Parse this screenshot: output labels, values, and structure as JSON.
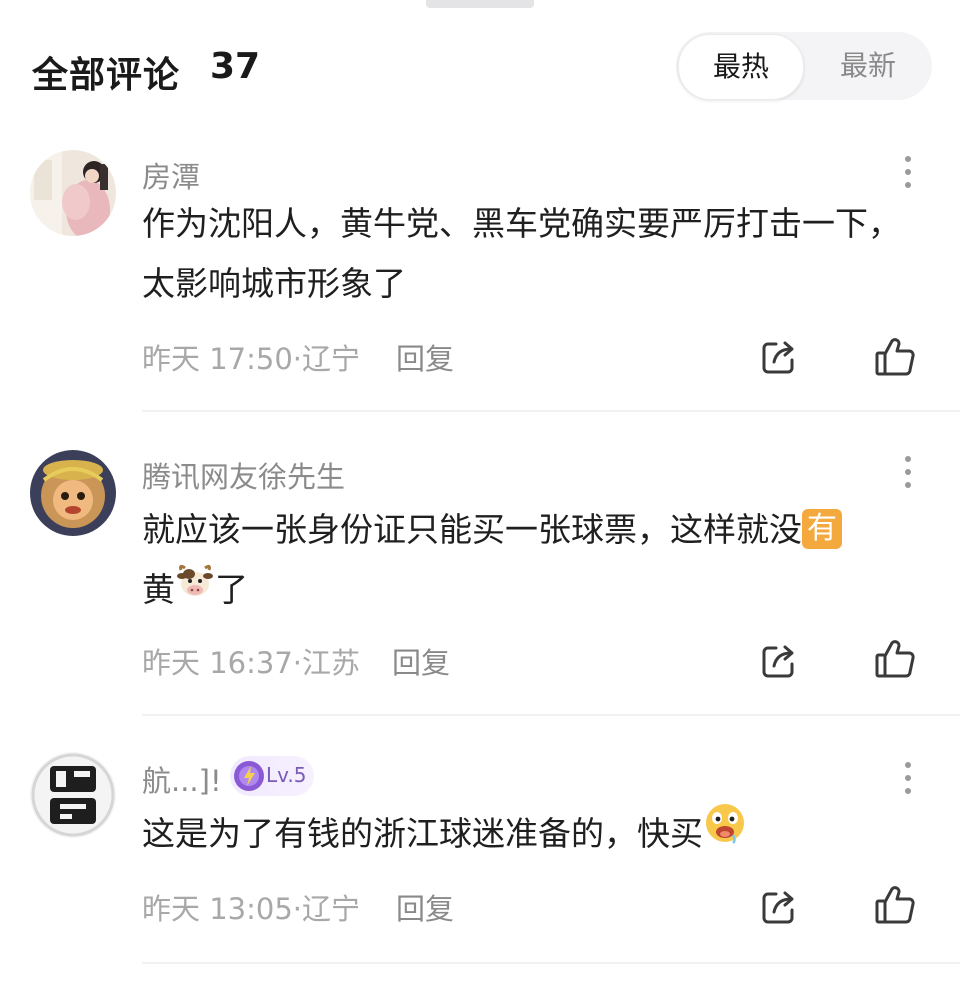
{
  "header": {
    "title": "全部评论",
    "count": "37",
    "sort_options": [
      "最热",
      "最新"
    ]
  },
  "comments": [
    {
      "username": "房潭",
      "content": "作为沈阳人，黄牛党、黑车党确实要严厉打击一下，太影响城市形象了",
      "meta": "昨天 17:50·辽宁",
      "reply": "回复"
    },
    {
      "username": "腾讯网友徐先生",
      "content_before": "就应该一张身份证只能买一张球票，这样就没",
      "badge": "有",
      "content_mid": "黄",
      "content_after": "了",
      "meta": "昨天 16:37·江苏",
      "reply": "回复"
    },
    {
      "username": "航...]!",
      "level": "Lv.5",
      "content": "这是为了有钱的浙江球迷准备的，快买",
      "meta": "昨天 13:05·辽宁",
      "reply": "回复"
    }
  ],
  "icons": [
    "more-icon",
    "share-icon",
    "like-icon",
    "cow-emoji",
    "drool-emoji"
  ],
  "colors": {
    "primary_text": "#1f1f1f",
    "secondary_text": "#8b8b8b",
    "meta_text": "#a8a8a8",
    "badge_orange": "#f4a93e",
    "toggle_bg": "#f4f4f6"
  }
}
